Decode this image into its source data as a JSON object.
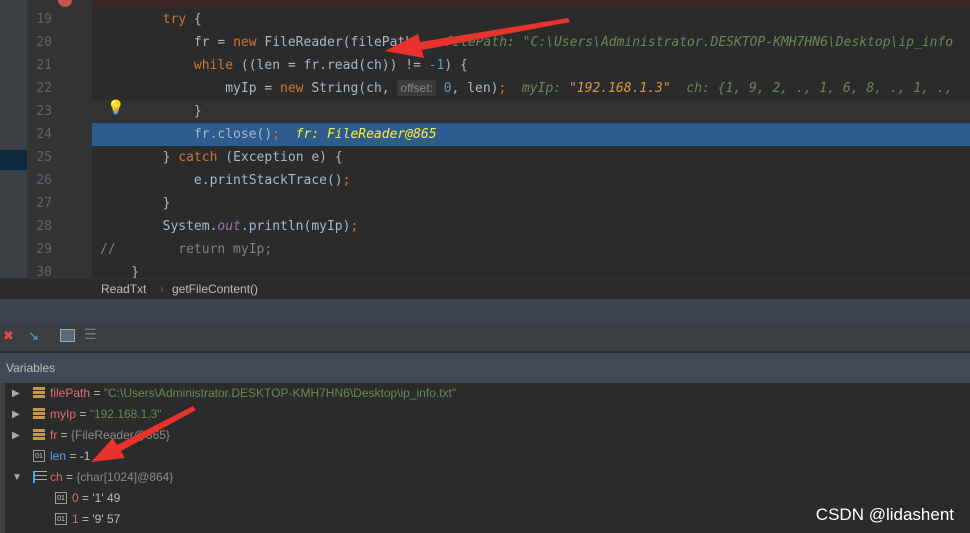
{
  "editor": {
    "lines": [
      {
        "n": "19",
        "segments": [
          [
            "        ",
            ""
          ],
          [
            "try",
            "kw"
          ],
          [
            " {",
            ""
          ]
        ]
      },
      {
        "n": "20",
        "segments": [
          [
            "            fr = ",
            ""
          ],
          [
            "new",
            "kw"
          ],
          [
            " FileReader(filePath)",
            ""
          ],
          [
            "   filePath: ",
            "hint"
          ],
          [
            "\"C:\\Users\\Administrator.DESKTOP-KMH7HN6\\Desktop\\ip_info",
            "hint"
          ]
        ]
      },
      {
        "n": "21",
        "segments": [
          [
            "            ",
            ""
          ],
          [
            "while",
            "kw"
          ],
          [
            " ((len = fr.read(ch)) != ",
            ""
          ],
          [
            "-1",
            "num"
          ],
          [
            ") {",
            ""
          ]
        ]
      },
      {
        "n": "22",
        "segments": [
          [
            "                myIp = ",
            ""
          ],
          [
            "new",
            "kw"
          ],
          [
            " String(ch, ",
            ""
          ],
          [
            "offset:",
            "param"
          ],
          [
            " ",
            ""
          ],
          [
            "0",
            "num"
          ],
          [
            ", len)",
            ""
          ],
          [
            ";",
            "kw"
          ],
          [
            "  myIp: ",
            "hint"
          ],
          [
            "\"192.168.1.3\"",
            "hintv"
          ],
          [
            "  ch: {1, 9, 2, ., 1, 6, 8, ., 1, .,",
            "hint"
          ]
        ]
      },
      {
        "n": "23",
        "segments": [
          [
            "            }",
            ""
          ]
        ]
      },
      {
        "n": "24",
        "segments": [
          [
            "            fr.close()",
            ""
          ],
          [
            ";",
            "kw"
          ],
          [
            "  fr: FileReader@865",
            "yel"
          ]
        ]
      },
      {
        "n": "25",
        "segments": [
          [
            "        } ",
            ""
          ],
          [
            "catch",
            "kw"
          ],
          [
            " (Exception e) {",
            ""
          ]
        ]
      },
      {
        "n": "26",
        "segments": [
          [
            "            e.printStackTrace()",
            ""
          ],
          [
            ";",
            "kw"
          ]
        ]
      },
      {
        "n": "27",
        "segments": [
          [
            "        }",
            ""
          ]
        ]
      },
      {
        "n": "28",
        "segments": [
          [
            "        System.",
            ""
          ],
          [
            "out",
            "purple"
          ],
          [
            ".println(myIp)",
            ""
          ],
          [
            ";",
            "kw"
          ]
        ]
      },
      {
        "n": "29",
        "segments": [
          [
            "//        return myIp;",
            "com"
          ]
        ]
      },
      {
        "n": "30",
        "segments": [
          [
            "    }",
            ""
          ]
        ]
      }
    ]
  },
  "breadcrumb": {
    "class": "ReadTxt",
    "method": "getFileContent()"
  },
  "variables": {
    "title": "Variables",
    "items": [
      {
        "name": "filePath",
        "eq": " = ",
        "value": "\"C:\\Users\\Administrator.DESKTOP-KMH7HN6\\Desktop\\ip_info.txt\"",
        "kind": "string",
        "icon": "object-icon",
        "expand": "collapsed"
      },
      {
        "name": "myIp",
        "eq": " = ",
        "value": "\"192.168.1.3\"",
        "kind": "string",
        "icon": "object-icon",
        "expand": "collapsed"
      },
      {
        "name": "fr",
        "eq": " = ",
        "value": "{FileReader@865}",
        "kind": "obj",
        "icon": "object-icon",
        "expand": "collapsed"
      },
      {
        "name": "len",
        "eq": " = ",
        "value": "-1",
        "kind": "prim",
        "icon": "primitive-icon",
        "expand": "none"
      },
      {
        "name": "ch",
        "eq": " = ",
        "value": "{char[1024]@864}",
        "kind": "obj",
        "icon": "array-icon",
        "expand": "expanded"
      },
      {
        "name": "0",
        "eq": " = ",
        "value": "'1' 49",
        "kind": "prim",
        "icon": "primitive-icon",
        "expand": "child"
      },
      {
        "name": "1",
        "eq": " = ",
        "value": "'9' 57",
        "kind": "prim",
        "icon": "primitive-icon",
        "expand": "child"
      }
    ]
  },
  "watermark": "CSDN @lidashent",
  "colors": {
    "highlight": "#2d5c8f",
    "arrow": "#e8322d"
  }
}
